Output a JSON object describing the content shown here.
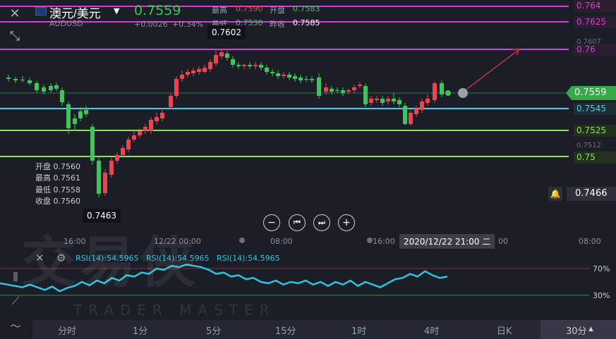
{
  "header": {
    "title": "澳元/美元",
    "symbol": "AUDUSD",
    "price": "0.7559",
    "change": "+0.0026",
    "change_pct": "+0.34%",
    "stats": [
      {
        "label": "最高",
        "value": "0.7590",
        "color": "#e8454f"
      },
      {
        "label": "开盘",
        "value": "0.7583",
        "color": "#3ec45a"
      },
      {
        "label": "最低",
        "value": "0.7530",
        "color": "#3ec45a"
      },
      {
        "label": "昨收",
        "value": "0.7585",
        "color": "#ffffff"
      }
    ]
  },
  "price_levels": [
    {
      "label": "0.764",
      "color": "#d93ad9",
      "bg": "#2a1f30"
    },
    {
      "label": "0.7625",
      "color": "#d93ad9",
      "bg": "#2a1f30"
    },
    {
      "label": "0.7607",
      "color": "#6b6f7a",
      "bg": ""
    },
    {
      "label": "0.76",
      "color": "#d93ad9",
      "bg": "#2a1f30"
    },
    {
      "label": "0.7559",
      "color": "#ffffff",
      "bg": "#35a847"
    },
    {
      "label": "0.7545",
      "color": "#3fd0e8",
      "bg": "#1f2d36"
    },
    {
      "label": "0.7525",
      "color": "#8de05c",
      "bg": "#22301f"
    },
    {
      "label": "0.7512",
      "color": "#6b6f7a",
      "bg": ""
    },
    {
      "label": "0.75",
      "color": "#8de05c",
      "bg": "#22301f"
    },
    {
      "label": "0.7466",
      "color": "#ffffff",
      "bg": "#2c303a"
    }
  ],
  "high_tag": "0.7602",
  "low_tag": "0.7463",
  "ohlc_box": {
    "open": "开盘 0.7560",
    "high": "最高 0.7561",
    "low": "最低 0.7558",
    "close": "收盘 0.7560"
  },
  "time_axis": [
    "16:00",
    "12/22 00:00",
    "08:00",
    "16:00",
    "08:00"
  ],
  "crosshair_time": "2020/12/22 21:00 二",
  "crosshair_time_tail": "00",
  "rsi": {
    "labels": [
      "RSI(14):54.5965",
      "RSI(14):54.5965",
      "RSI(14):54.5965"
    ],
    "upper": "70%",
    "lower": "30%",
    "values": [
      48,
      46,
      44,
      42,
      46,
      42,
      38,
      43,
      36,
      41,
      44,
      50,
      45,
      52,
      48,
      56,
      52,
      60,
      58,
      64,
      62,
      70,
      68,
      74,
      72,
      76,
      74,
      72,
      68,
      62,
      64,
      58,
      60,
      54,
      56,
      50,
      48,
      52,
      46,
      50,
      48,
      52,
      46,
      50,
      44,
      50,
      46,
      52,
      44,
      50,
      46,
      42,
      48,
      54,
      56,
      62,
      58,
      66,
      60,
      56,
      58
    ]
  },
  "timeframes": [
    "分时",
    "1分",
    "5分",
    "15分",
    "1时",
    "4时",
    "日K",
    "30分"
  ],
  "active_timeframe": "30分",
  "watermark": "交易侠",
  "watermark_en": "TRADER MASTER",
  "colors": {
    "up": "#e8454f",
    "down": "#3ec45a",
    "magenta": "#d93ad9",
    "cyan": "#3fd0e8",
    "green_line": "#8de05c"
  }
}
